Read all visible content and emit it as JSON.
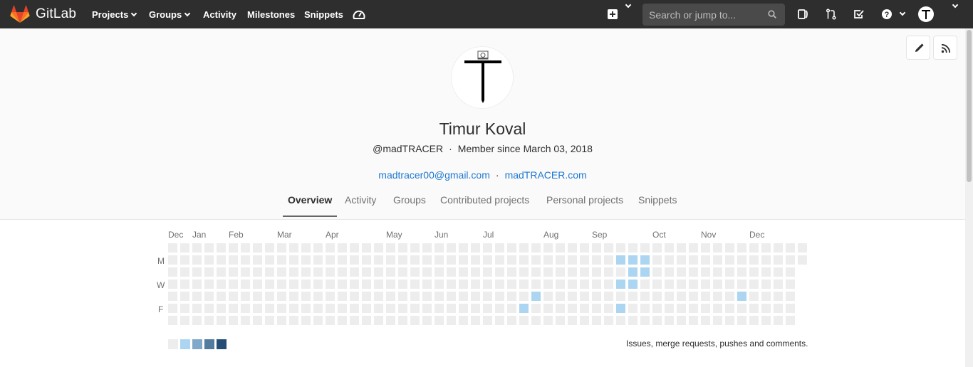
{
  "navbar": {
    "brand": "GitLab",
    "items": [
      {
        "label": "Projects",
        "has_caret": true
      },
      {
        "label": "Groups",
        "has_caret": true
      },
      {
        "label": "Activity",
        "has_caret": false
      },
      {
        "label": "Milestones",
        "has_caret": false
      },
      {
        "label": "Snippets",
        "has_caret": false
      }
    ],
    "search_placeholder": "Search or jump to...",
    "icons": [
      "gauge-icon",
      "plus-icon",
      "sidebar-toggle-icon",
      "merge-request-icon",
      "todo-check-icon",
      "help-icon",
      "user-avatar"
    ]
  },
  "actions": {
    "edit_icon": "pencil-icon",
    "rss_icon": "rss-icon"
  },
  "profile": {
    "name": "Timur Koval",
    "username": "@madTRACER",
    "member_since": "Member since March 03, 2018",
    "email": "madtracer00@gmail.com",
    "website": "madTRACER.com"
  },
  "tabs": [
    {
      "label": "Overview",
      "active": true
    },
    {
      "label": "Activity",
      "active": false
    },
    {
      "label": "Groups",
      "active": false
    },
    {
      "label": "Contributed projects",
      "active": false
    },
    {
      "label": "Personal projects",
      "active": false
    },
    {
      "label": "Snippets",
      "active": false
    }
  ],
  "calendar": {
    "months": [
      "Dec",
      "Jan",
      "Feb",
      "Mar",
      "Apr",
      "May",
      "Jun",
      "Jul",
      "Aug",
      "Sep",
      "Oct",
      "Nov",
      "Dec"
    ],
    "day_labels": [
      "M",
      "W",
      "F"
    ],
    "colors": {
      "empty": "#ededed",
      "level1": "#acd5f2",
      "level2": "#7fa8c9",
      "level3": "#527ba0",
      "level4": "#254e77"
    },
    "legend_text": "Issues, merge requests, pushes and comments."
  }
}
